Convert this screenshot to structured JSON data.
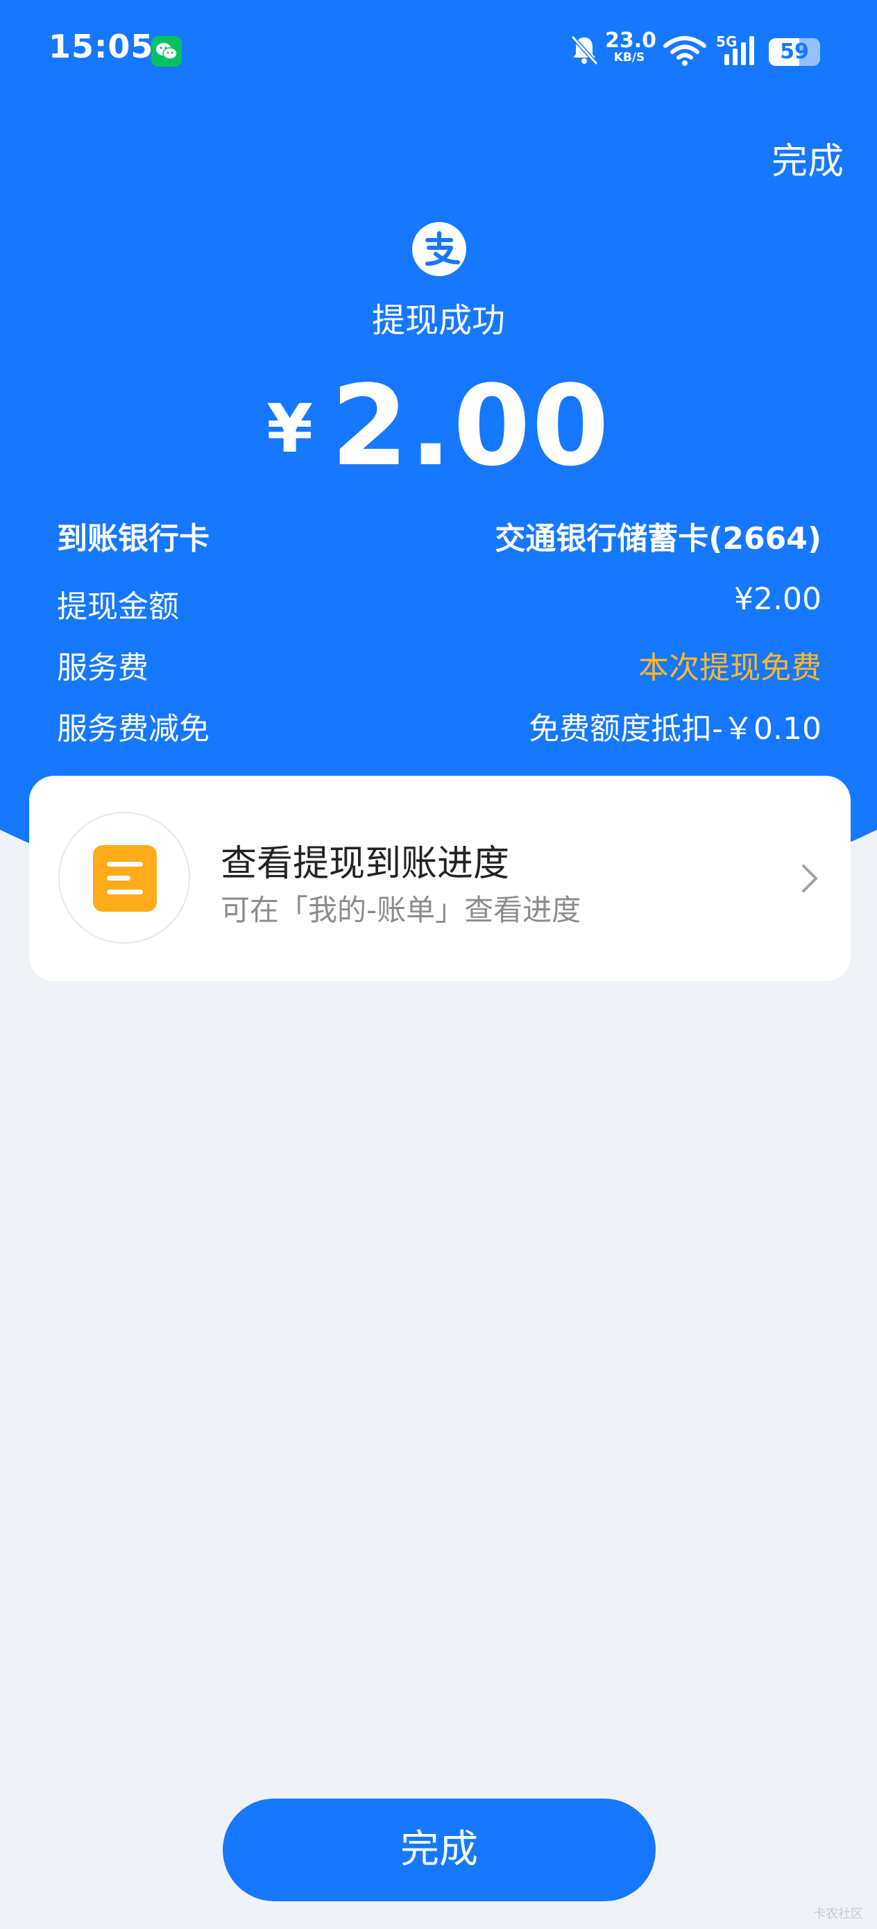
{
  "status_bar": {
    "time": "15:05",
    "net_speed": "23.0",
    "net_speed_unit": "KB/S",
    "network": "5G",
    "battery": "59"
  },
  "header": {
    "done_label": "完成",
    "title": "提现成功"
  },
  "amount": {
    "currency": "¥",
    "value": "2.00"
  },
  "details": [
    {
      "label": "到账银行卡",
      "value": "交通银行储蓄卡(2664)"
    },
    {
      "label": "提现金额",
      "value": "¥2.00"
    },
    {
      "label": "服务费",
      "value": "本次提现免费"
    },
    {
      "label": "服务费减免",
      "value": "免费额度抵扣-￥0.10"
    }
  ],
  "progress_card": {
    "title": "查看提现到账进度",
    "subtitle": "可在「我的-账单」查看进度"
  },
  "footer": {
    "done_label": "完成",
    "watermark": "卡农社区"
  },
  "colors": {
    "primary": "#1677FF",
    "accent_orange": "#FFB72B",
    "background": "#EFF3F8"
  },
  "icons": [
    "wechat-icon",
    "mute-bell-icon",
    "wifi-icon",
    "signal-icon",
    "battery-icon",
    "alipay-logo-icon",
    "bill-list-icon",
    "chevron-right-icon"
  ]
}
